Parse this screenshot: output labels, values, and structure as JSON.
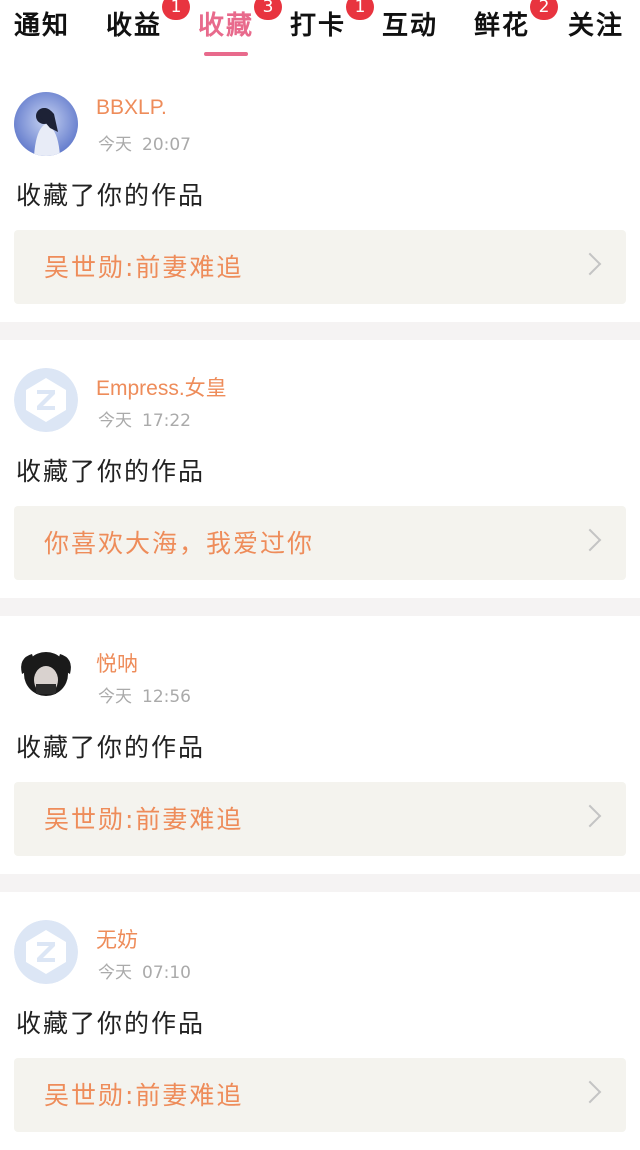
{
  "tabs": [
    {
      "label": "通知",
      "badge": ""
    },
    {
      "label": "收益",
      "badge": "1"
    },
    {
      "label": "收藏",
      "badge": "3",
      "active": true
    },
    {
      "label": "打卡",
      "badge": "1"
    },
    {
      "label": "互动",
      "badge": ""
    },
    {
      "label": "鲜花",
      "badge": "2"
    },
    {
      "label": "关注",
      "badge": ""
    }
  ],
  "items": [
    {
      "username": "BBXLP.",
      "day": "今天",
      "time": "20:07",
      "action": "收藏了你的作品",
      "work": "吴世勋:前妻难追",
      "avatar": "photo-blue"
    },
    {
      "username": "Empress.女皇",
      "day": "今天",
      "time": "17:22",
      "action": "收藏了你的作品",
      "work": "你喜欢大海，我爱过你",
      "avatar": "default-z"
    },
    {
      "username": "悦呐",
      "day": "今天",
      "time": "12:56",
      "action": "收藏了你的作品",
      "work": "吴世勋:前妻难追",
      "avatar": "photo-bw"
    },
    {
      "username": "无妨",
      "day": "今天",
      "time": "07:10",
      "action": "收藏了你的作品",
      "work": "吴世勋:前妻难追",
      "avatar": "default-z"
    }
  ],
  "colors": {
    "accent": "#e86a8c",
    "username": "#ee8c5a",
    "badge": "#e8343f",
    "card_bg": "#f4f3ee"
  }
}
